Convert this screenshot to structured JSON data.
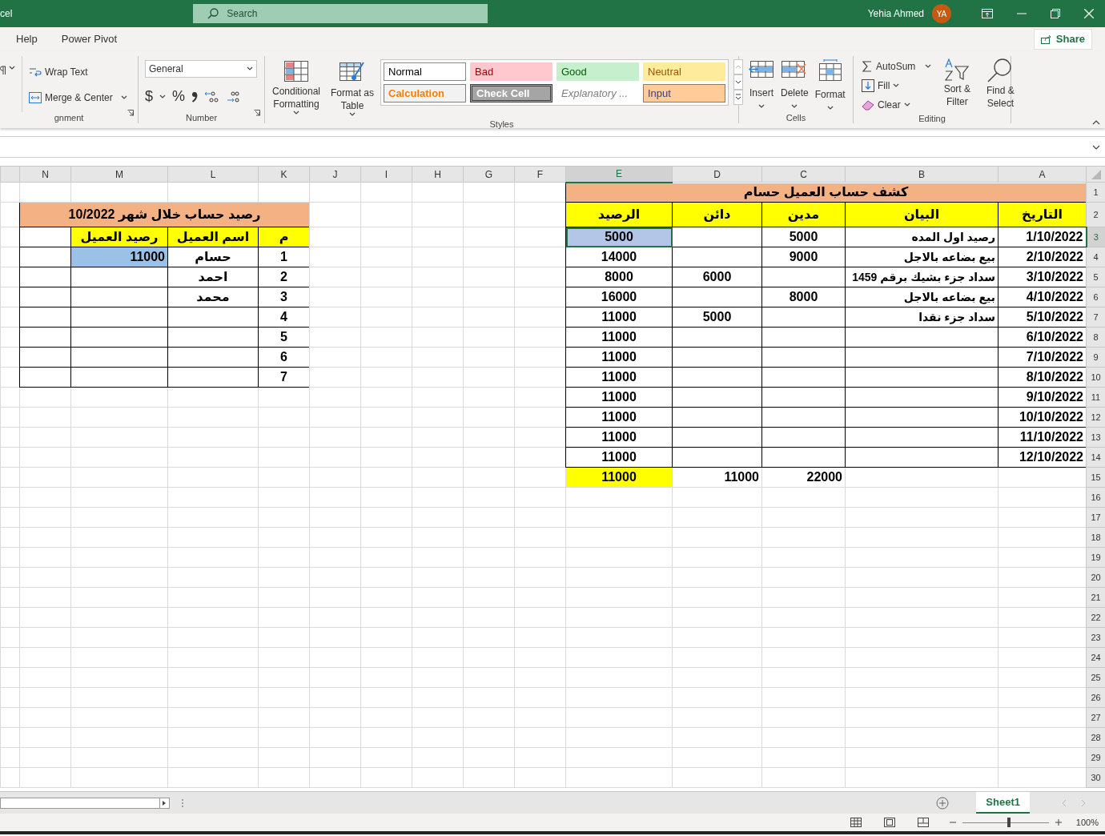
{
  "title_bar": {
    "app": "cel",
    "search_placeholder": "Search",
    "user": "Yehia Ahmed",
    "initials": "YA"
  },
  "ribbon_tabs": [
    {
      "label": "Help"
    },
    {
      "label": "Power Pivot"
    }
  ],
  "share": "Share",
  "groups": [
    {
      "kind": "alignment",
      "label": "gnment",
      "items": [
        "Wrap Text",
        "Merge & Center"
      ]
    },
    {
      "kind": "number",
      "label": "Number",
      "format": "General",
      "symbols": [
        "$",
        "%"
      ]
    },
    {
      "kind": "styles",
      "label": "Styles",
      "buttons": [
        "Conditional Formatting",
        "Format as Table"
      ],
      "styles": [
        {
          "label": "Normal",
          "kind": "normal"
        },
        {
          "label": "Bad",
          "kind": "bad"
        },
        {
          "label": "Good",
          "kind": "good"
        },
        {
          "label": "Neutral",
          "kind": "neutral"
        },
        {
          "label": "Calculation",
          "kind": "calculation"
        },
        {
          "label": "Check Cell",
          "kind": "check"
        },
        {
          "label": "Explanatory ...",
          "kind": "explanatory"
        },
        {
          "label": "Input",
          "kind": "input"
        }
      ]
    },
    {
      "kind": "cells",
      "label": "Cells",
      "buttons": [
        "Insert",
        "Delete",
        "Format"
      ]
    },
    {
      "kind": "editing",
      "label": "Editing",
      "items": [
        "AutoSum",
        "Fill",
        "Clear"
      ],
      "buttons": [
        "Sort & Filter",
        "Find & Select"
      ]
    }
  ],
  "sheet": {
    "column_headers": [
      {
        "label": "N",
        "selected": false
      },
      {
        "label": "M",
        "selected": false
      },
      {
        "label": "L",
        "selected": false
      },
      {
        "label": "K",
        "selected": false
      },
      {
        "label": "J",
        "selected": false
      },
      {
        "label": "I",
        "selected": false
      },
      {
        "label": "H",
        "selected": false
      },
      {
        "label": "G",
        "selected": false
      },
      {
        "label": "F",
        "selected": false
      },
      {
        "label": "E",
        "selected": true
      },
      {
        "label": "D",
        "selected": false
      },
      {
        "label": "C",
        "selected": false
      },
      {
        "label": "B",
        "selected": false
      },
      {
        "label": "A",
        "selected": false
      }
    ],
    "row_headers": [
      {
        "label": "1",
        "selected": false
      },
      {
        "label": "2",
        "selected": false
      },
      {
        "label": "3",
        "selected": true
      },
      {
        "label": "4",
        "selected": false
      },
      {
        "label": "5",
        "selected": false
      },
      {
        "label": "6",
        "selected": false
      },
      {
        "label": "7",
        "selected": false
      },
      {
        "label": "8",
        "selected": false
      },
      {
        "label": "9",
        "selected": false
      },
      {
        "label": "10",
        "selected": false
      },
      {
        "label": "11",
        "selected": false
      },
      {
        "label": "12",
        "selected": false
      },
      {
        "label": "13",
        "selected": false
      },
      {
        "label": "14",
        "selected": false
      },
      {
        "label": "15",
        "selected": false
      },
      {
        "label": "16",
        "selected": false
      },
      {
        "label": "17",
        "selected": false
      },
      {
        "label": "18",
        "selected": false
      },
      {
        "label": "19",
        "selected": false
      },
      {
        "label": "20",
        "selected": false
      },
      {
        "label": "21",
        "selected": false
      },
      {
        "label": "22",
        "selected": false
      },
      {
        "label": "23",
        "selected": false
      },
      {
        "label": "24",
        "selected": false
      },
      {
        "label": "25",
        "selected": false
      },
      {
        "label": "26",
        "selected": false
      },
      {
        "label": "27",
        "selected": false
      },
      {
        "label": "28",
        "selected": false
      },
      {
        "label": "29",
        "selected": false
      },
      {
        "label": "30",
        "selected": false
      }
    ],
    "statement": {
      "title": "كشف حساب العميل حسام",
      "columns": [
        "التاريخ",
        "البيان",
        "مدين",
        "دائن",
        "الرصيد"
      ],
      "rows": [
        {
          "date": "1/10/2022",
          "description": "رصيد اول المده",
          "debit": "5000",
          "balance": "5000",
          "selected": true
        },
        {
          "date": "2/10/2022",
          "description": "بيع بضاعه بالاجل",
          "debit": "9000",
          "balance": "14000",
          "selected": false
        },
        {
          "date": "3/10/2022",
          "description": "سداد جزء بشيك برقم 1459",
          "credit": "6000",
          "balance": "8000",
          "selected": false
        },
        {
          "date": "4/10/2022",
          "description": "بيع بضاعه بالاجل",
          "debit": "8000",
          "balance": "16000",
          "selected": false
        },
        {
          "date": "5/10/2022",
          "description": "سداد جزء نقدا",
          "credit": "5000",
          "balance": "11000",
          "selected": false
        },
        {
          "date": "6/10/2022",
          "balance": "11000",
          "selected": false
        },
        {
          "date": "7/10/2022",
          "balance": "11000",
          "selected": false
        },
        {
          "date": "8/10/2022",
          "balance": "11000",
          "selected": false
        },
        {
          "date": "9/10/2022",
          "balance": "11000",
          "selected": false
        },
        {
          "date": "10/10/2022",
          "balance": "11000",
          "selected": false
        },
        {
          "date": "11/10/2022",
          "balance": "11000",
          "selected": false
        },
        {
          "date": "12/10/2022",
          "balance": "11000",
          "selected": false
        }
      ],
      "totals": {
        "debit": "22000",
        "credit": "11000",
        "balance": "11000"
      }
    },
    "summary": {
      "title": "رصيد حساب خلال شهر 10/2022",
      "columns": [
        "م",
        "اسم العميل",
        "رصيد العميل"
      ],
      "rows": [
        {
          "number": "1",
          "name": "حسام",
          "balance": "11000",
          "highlighted": true
        },
        {
          "number": "2",
          "name": "احمد",
          "highlighted": false
        },
        {
          "number": "3",
          "name": "محمد",
          "highlighted": false
        },
        {
          "number": "4",
          "highlighted": false
        },
        {
          "number": "5",
          "highlighted": false
        },
        {
          "number": "6",
          "highlighted": false
        },
        {
          "number": "7",
          "highlighted": false
        }
      ]
    }
  },
  "sheet_tabs": [
    {
      "label": "Sheet1",
      "selected": true
    }
  ],
  "zoom": {
    "level": 0.52,
    "reading": "100%"
  }
}
